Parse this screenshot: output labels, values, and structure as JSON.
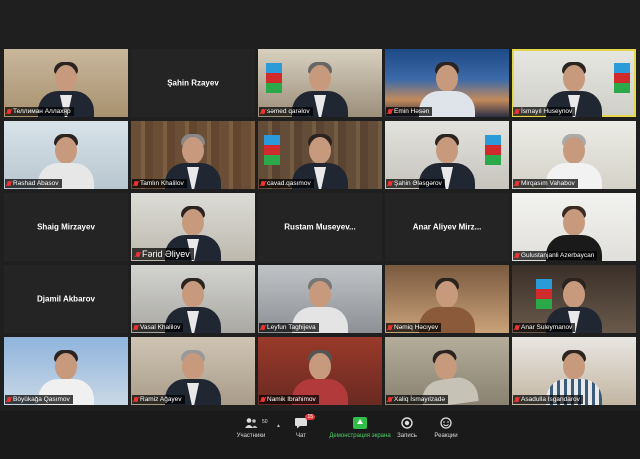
{
  "tiles": [
    {
      "name": "Теллиман Аллахяр",
      "type": "video"
    },
    {
      "name": "Şahin Rzayev",
      "type": "name"
    },
    {
      "name": "səmed qarəlov",
      "type": "video"
    },
    {
      "name": "Emin Həsən",
      "type": "video"
    },
    {
      "name": "İsmayıl Huseynov",
      "type": "video"
    },
    {
      "name": "Rəshad Abasov",
      "type": "video"
    },
    {
      "name": "Tamlın Khalilov",
      "type": "video"
    },
    {
      "name": "cavad.qasımov",
      "type": "video"
    },
    {
      "name": "Şahin Ələsgərov",
      "type": "video"
    },
    {
      "name": "Mirqasım Vahabov",
      "type": "video"
    },
    {
      "name": "Shaig Mirzayev",
      "type": "name"
    },
    {
      "name": "Fərid Əliyev",
      "type": "video"
    },
    {
      "name": "Rustam Museyev...",
      "type": "name"
    },
    {
      "name": "Anar Aliyev Mirz...",
      "type": "name"
    },
    {
      "name": "Gulustanjanli Azerbaycan",
      "type": "video"
    },
    {
      "name": "Djamil Akbarov",
      "type": "name"
    },
    {
      "name": "Vasal Khalilov",
      "type": "video"
    },
    {
      "name": "Leyfun Taghijeva",
      "type": "video"
    },
    {
      "name": "Nəmiq Həcıyev",
      "type": "video"
    },
    {
      "name": "Anar Suleymanov",
      "type": "video"
    },
    {
      "name": "Böyükağa Qasımov",
      "type": "video"
    },
    {
      "name": "Ramiz Ağayev",
      "type": "video"
    },
    {
      "name": "Namik Ibrahimov",
      "type": "video"
    },
    {
      "name": "Xaliq İsmayılzadə",
      "type": "video"
    },
    {
      "name": "Asadulla Isgandarov",
      "type": "video"
    }
  ],
  "toolbar": {
    "participants_label": "Участники",
    "participants_count": "50",
    "chat_label": "Чат",
    "chat_badge": "15",
    "share_label": "Демонстрация экрана",
    "record_label": "Запись",
    "reactions_label": "Реакции"
  },
  "colors": {
    "share_green": "#2fbf4a",
    "active_speaker": "#e6d64a",
    "mic_muted": "#e33333"
  }
}
